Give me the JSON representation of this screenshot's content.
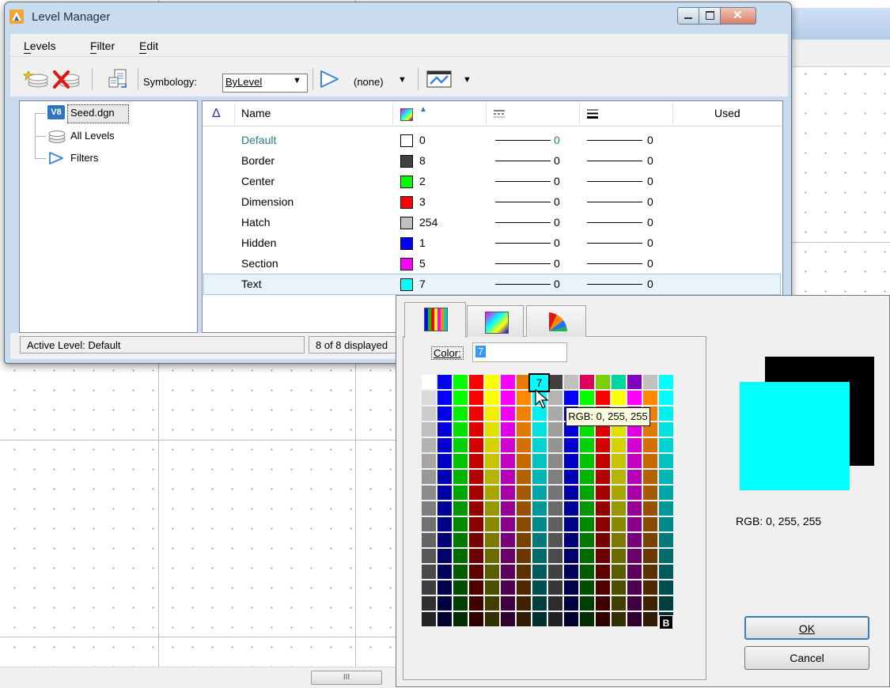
{
  "colors": {
    "title_bar": "#c9dbef",
    "accent": "#3399ff",
    "selected_color": "#00ffff"
  },
  "level_manager": {
    "title": "Level Manager",
    "window_controls": [
      "minimize-icon",
      "maximize-icon",
      "close-icon"
    ],
    "menu": [
      "Levels",
      "Filter",
      "Edit"
    ],
    "toolbar": {
      "symbology_label": "Symbology:",
      "symbology_value": "ByLevel",
      "filter_value": "(none)",
      "icons": [
        "new-level-icon",
        "delete-level-icon",
        "import-export-icon",
        "filter-icon",
        "level-display-icon"
      ]
    },
    "tree": {
      "items": [
        "Seed.dgn",
        "All Levels",
        "Filters"
      ],
      "root_badge": "V8"
    },
    "columns": {
      "name": "Name",
      "used": "Used",
      "icons": [
        "sort-ascending-icon",
        "color-column-icon",
        "sort-indicator-icon",
        "line-style-column-icon",
        "line-weight-column-icon"
      ]
    },
    "levels": [
      {
        "name": "Default",
        "color": "#ffffff",
        "color_num": "0",
        "style": "0",
        "weight": "0"
      },
      {
        "name": "Border",
        "color": "#404040",
        "color_num": "8",
        "style": "0",
        "weight": "0"
      },
      {
        "name": "Center",
        "color": "#00ff00",
        "color_num": "2",
        "style": "0",
        "weight": "0"
      },
      {
        "name": "Dimension",
        "color": "#ff0000",
        "color_num": "3",
        "style": "0",
        "weight": "0"
      },
      {
        "name": "Hatch",
        "color": "#c0c0c0",
        "color_num": "254",
        "style": "0",
        "weight": "0"
      },
      {
        "name": "Hidden",
        "color": "#0000ff",
        "color_num": "1",
        "style": "0",
        "weight": "0"
      },
      {
        "name": "Section",
        "color": "#ff00ff",
        "color_num": "5",
        "style": "0",
        "weight": "0"
      },
      {
        "name": "Text",
        "color": "#00ffff",
        "color_num": "7",
        "style": "0",
        "weight": "0"
      }
    ],
    "status": {
      "active_level": "Active Level: Default",
      "count": "8 of 8 displayed"
    }
  },
  "color_picker": {
    "tabs": [
      "color-book-icon",
      "true-color-icon",
      "color-wheel-icon"
    ],
    "color_label": "Color:",
    "color_value": "7",
    "hover_index": "7",
    "tooltip": "RGB: 0, 255, 255",
    "preview_rgb": "RGB: 0, 255, 255",
    "last_cell_label": "B",
    "ok_label": "OK",
    "cancel_label": "Cancel"
  },
  "scrollbar": {
    "thumb_grip": "III"
  }
}
